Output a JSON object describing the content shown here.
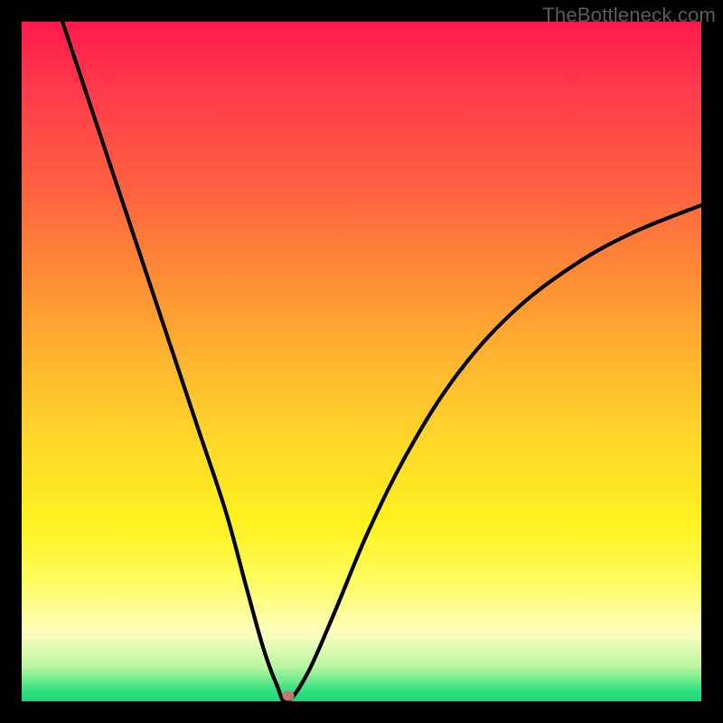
{
  "watermark": "TheBottleneck.com",
  "chart_data": {
    "type": "line",
    "title": "",
    "xlabel": "",
    "ylabel": "",
    "xlim": [
      0,
      100
    ],
    "ylim": [
      0,
      100
    ],
    "series": [
      {
        "name": "bottleneck-curve",
        "x": [
          6,
          10,
          14,
          18,
          22,
          26,
          30,
          33,
          35.5,
          37.5,
          39,
          42,
          46,
          51,
          57,
          64,
          72,
          81,
          90,
          100
        ],
        "values": [
          100,
          88,
          76,
          64,
          52,
          40,
          28,
          17,
          8,
          2.5,
          0,
          4,
          13,
          25,
          37,
          48,
          57,
          64,
          69,
          73
        ]
      }
    ],
    "marker": {
      "x": 39.2,
      "y": 0.8
    },
    "gradient_stops": [
      {
        "pos": 0,
        "color": "#ff1a4c"
      },
      {
        "pos": 0.1,
        "color": "#ff3a4c"
      },
      {
        "pos": 0.25,
        "color": "#ff633f"
      },
      {
        "pos": 0.38,
        "color": "#ff8e35"
      },
      {
        "pos": 0.5,
        "color": "#ffb62f"
      },
      {
        "pos": 0.62,
        "color": "#ffd828"
      },
      {
        "pos": 0.74,
        "color": "#fff220"
      },
      {
        "pos": 0.82,
        "color": "#fffc5c"
      },
      {
        "pos": 0.9,
        "color": "#fcfec0"
      },
      {
        "pos": 0.95,
        "color": "#b8f5a0"
      },
      {
        "pos": 0.985,
        "color": "#2fe07f"
      },
      {
        "pos": 1.0,
        "color": "#1fd877"
      }
    ],
    "colors": {
      "curve": "#000000",
      "frame": "#000000",
      "marker": "#c47b6b",
      "watermark": "#5b5b5b"
    }
  }
}
